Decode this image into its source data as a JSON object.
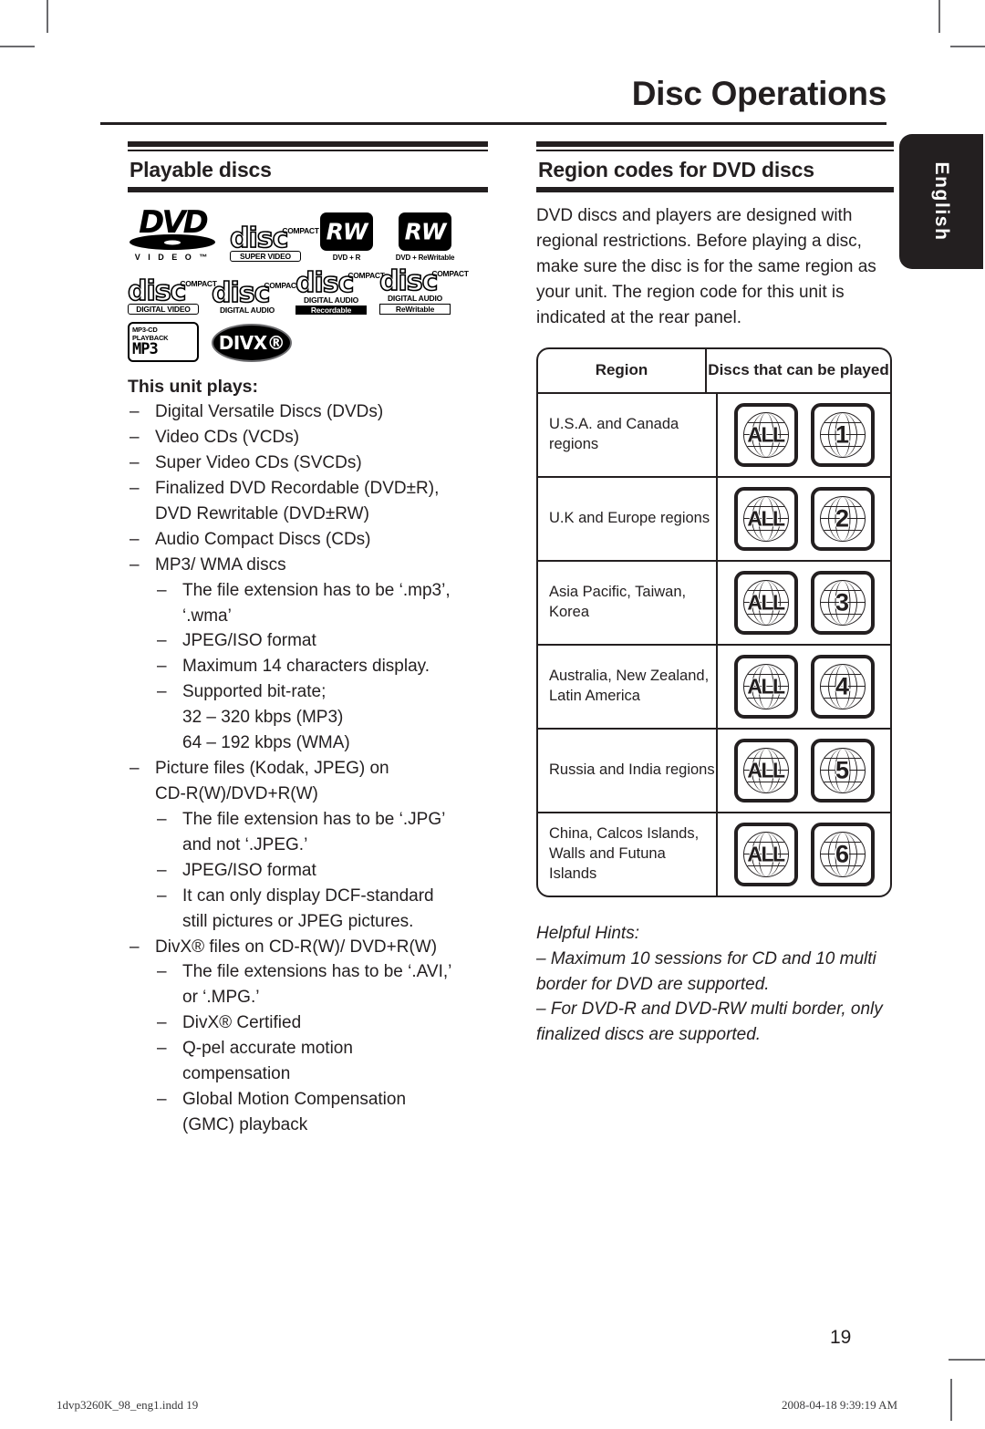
{
  "header": {
    "title": "Disc Operations",
    "side_tab": "English"
  },
  "left_column": {
    "heading": "Playable discs",
    "logos": [
      {
        "name": "dvd-video-logo",
        "word": "DVD",
        "caption": "V I D E O ™"
      },
      {
        "name": "compact-disc-super-video-logo",
        "top": "COMPACT",
        "word": "disc",
        "caption": "SUPER  VIDEO"
      },
      {
        "name": "dvd-plus-r-logo",
        "chip": "RW",
        "caption": "DVD + R"
      },
      {
        "name": "dvd-plus-rewritable-logo",
        "chip": "RW",
        "caption": "DVD + ReWritable"
      },
      {
        "name": "compact-disc-digital-video-logo",
        "top": "COMPACT",
        "word": "disc",
        "caption": "DIGITAL VIDEO"
      },
      {
        "name": "compact-disc-digital-audio-logo",
        "top": "COMPACT",
        "word": "disc",
        "caption": "DIGITAL AUDIO"
      },
      {
        "name": "compact-disc-recordable-logo",
        "top": "COMPACT",
        "word": "disc",
        "caption": "DIGITAL AUDIO",
        "caption2": "Recordable"
      },
      {
        "name": "compact-disc-rewritable-logo",
        "top": "COMPACT",
        "word": "disc",
        "caption": "DIGITAL AUDIO",
        "caption2": "ReWritable"
      },
      {
        "name": "mp3-cd-playback-logo",
        "top": "MP3-CD PLAYBACK",
        "word": "MP3"
      },
      {
        "name": "divx-logo",
        "word": "DIVX®"
      }
    ],
    "unit_plays_title": "This unit plays:",
    "items": [
      {
        "level": 1,
        "text": "Digital Versatile Discs (DVDs)"
      },
      {
        "level": 1,
        "text": "Video CDs (VCDs)"
      },
      {
        "level": 1,
        "text": "Super Video CDs (SVCDs)"
      },
      {
        "level": 1,
        "text": "Finalized DVD Recordable (DVD±R),"
      },
      {
        "level": 1,
        "cont": true,
        "text": "DVD Rewritable (DVD±RW)"
      },
      {
        "level": 1,
        "text": "Audio Compact Discs (CDs)"
      },
      {
        "level": 1,
        "text": "MP3/ WMA discs"
      },
      {
        "level": 2,
        "text": "The file extension has to be ‘.mp3’,"
      },
      {
        "level": 2,
        "cont": true,
        "text": "‘.wma’"
      },
      {
        "level": 2,
        "text": "JPEG/ISO format"
      },
      {
        "level": 2,
        "text": "Maximum 14 characters display."
      },
      {
        "level": 2,
        "text": "Supported bit-rate;"
      },
      {
        "level": 2,
        "cont": true,
        "text": "32 – 320 kbps (MP3)"
      },
      {
        "level": 2,
        "cont": true,
        "text": "64 – 192 kbps (WMA)"
      },
      {
        "level": 1,
        "text": "Picture files (Kodak, JPEG) on"
      },
      {
        "level": 1,
        "cont": true,
        "text": "CD-R(W)/DVD+R(W)"
      },
      {
        "level": 2,
        "text": "The file extension has to be ‘.JPG’"
      },
      {
        "level": 2,
        "cont": true,
        "text": "and not ‘.JPEG.’"
      },
      {
        "level": 2,
        "text": "JPEG/ISO format"
      },
      {
        "level": 2,
        "text": "It can only display DCF-standard"
      },
      {
        "level": 2,
        "cont": true,
        "text": "still pictures or JPEG pictures."
      },
      {
        "level": 1,
        "text": "DivX® files on CD-R(W)/ DVD+R(W)"
      },
      {
        "level": 2,
        "text": "The file extensions has to be ‘.AVI,’"
      },
      {
        "level": 2,
        "cont": true,
        "text": "or ‘.MPG.’"
      },
      {
        "level": 2,
        "text": "DivX® Certified"
      },
      {
        "level": 2,
        "text": "Q-pel accurate motion"
      },
      {
        "level": 2,
        "cont": true,
        "text": "compensation"
      },
      {
        "level": 2,
        "text": "Global Motion Compensation"
      },
      {
        "level": 2,
        "cont": true,
        "text": "(GMC) playback"
      }
    ],
    "dash": "–"
  },
  "right_column": {
    "heading": "Region codes for DVD discs",
    "intro": "DVD discs and players are designed with regional restrictions. Before playing a disc, make sure the disc is for the same region as your unit. The region code for this unit is indicated at the rear panel.",
    "table": {
      "columns": [
        "Region",
        "Discs that can be played"
      ],
      "rows": [
        {
          "region": "U.S.A. and Canada regions",
          "discs": [
            "ALL",
            "1"
          ]
        },
        {
          "region": "U.K and Europe regions",
          "discs": [
            "ALL",
            "2"
          ]
        },
        {
          "region": "Asia Pacific, Taiwan, Korea",
          "discs": [
            "ALL",
            "3"
          ]
        },
        {
          "region": "Australia, New Zealand, Latin America",
          "discs": [
            "ALL",
            "4"
          ]
        },
        {
          "region": "Russia and India regions",
          "discs": [
            "ALL",
            "5"
          ]
        },
        {
          "region": "China, Calcos Islands, Walls and Futuna Islands",
          "discs": [
            "ALL",
            "6"
          ]
        }
      ]
    },
    "hints": {
      "title": "Helpful Hints:",
      "items": [
        "–  Maximum 10 sessions for CD and 10 multi border for DVD are supported.",
        "–  For DVD-R and DVD-RW multi border, only finalized discs are supported."
      ]
    }
  },
  "footer": {
    "page_number": "19",
    "file_name": "1dvp3260K_98_eng1.indd   19",
    "timestamp": "2008-04-18   9:39:19 AM"
  },
  "colors": {
    "ink": "#231f20",
    "crop_mark": "#6b6b6e",
    "paper": "#ffffff"
  }
}
